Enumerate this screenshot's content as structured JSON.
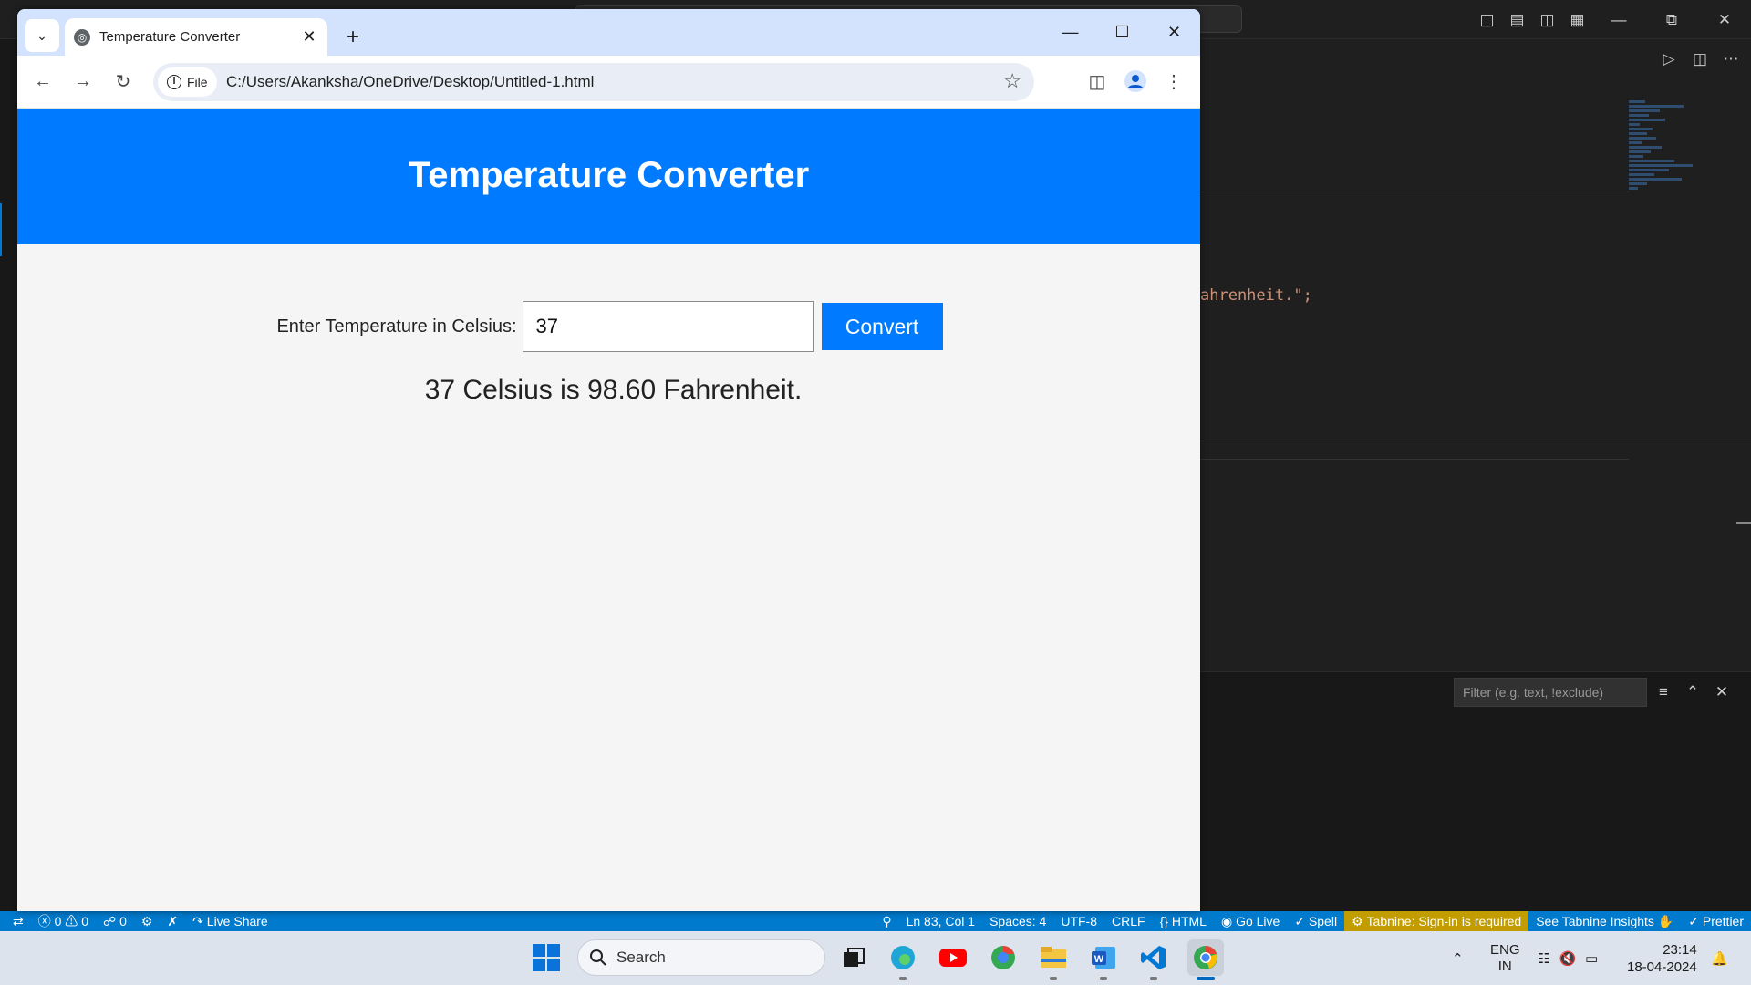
{
  "browser": {
    "tab_title": "Temperature Converter",
    "chip_label": "File",
    "url": "C:/Users/Akanksha/OneDrive/Desktop/Untitled-1.html"
  },
  "page": {
    "heading": "Temperature Converter",
    "input_label": "Enter Temperature in Celsius:",
    "input_value": "37",
    "button_label": "Convert",
    "result": "37 Celsius is 98.60 Fahrenheit."
  },
  "vscode": {
    "code_fragment": "ahrenheit.\";",
    "filter_placeholder": "Filter (e.g. text, !exclude)",
    "status_left": {
      "problems": "ⓧ 0 ⚠ 0",
      "ports": "0",
      "live_share": "Live Share"
    },
    "status_right": {
      "position": "Ln 83, Col 1",
      "spaces": "Spaces: 4",
      "encoding": "UTF-8",
      "eol": "CRLF",
      "language": "HTML",
      "go_live": "Go Live",
      "spell": "Spell",
      "tabnine": "Tabnine: Sign-in is required",
      "tabnine_insights": "See Tabnine Insights",
      "prettier": "Prettier"
    }
  },
  "taskbar": {
    "search_label": "Search",
    "language_top": "ENG",
    "language_bottom": "IN",
    "time": "23:14",
    "date": "18-04-2024"
  },
  "colors": {
    "header_blue": "#007bff",
    "statusbar_blue": "#007acc",
    "tabnine_gold": "#c29d00"
  }
}
